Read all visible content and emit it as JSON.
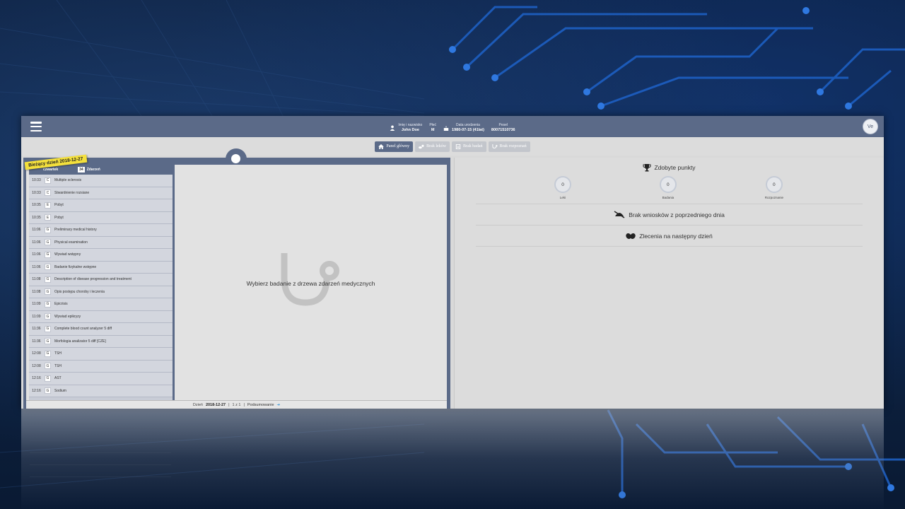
{
  "header": {
    "patient": {
      "name_label": "Imię i nazwisko",
      "name_value": "John Doe",
      "sex_label": "Płeć",
      "sex_value": "M",
      "dob_label": "Data urodzenia",
      "dob_value": "1980-07-15 (41lat)",
      "pesel_label": "Pesel",
      "pesel_value": "80071510736"
    },
    "avatar_initials": "Ve"
  },
  "nav": {
    "items": [
      {
        "label": "Panel główny",
        "icon": "home-icon",
        "active": true
      },
      {
        "label": "Brak leków",
        "icon": "pills-icon",
        "active": false
      },
      {
        "label": "Brak badań",
        "icon": "clipboard-icon",
        "active": false
      },
      {
        "label": "Brak rozpoznań",
        "icon": "stethoscope-icon",
        "active": false
      }
    ]
  },
  "events_panel": {
    "current_day_badge": "Bieżący dzień 2018-12-27",
    "day_name": "czwartek",
    "events_count": "34",
    "events_label": "Zdarzeń",
    "rows": [
      {
        "time": "10:33",
        "kind": "C",
        "title": "Multiple sclerosis"
      },
      {
        "time": "10:33",
        "kind": "C",
        "title": "Stwardnienie rozsiane"
      },
      {
        "time": "10:35",
        "kind": "E",
        "title": "Pobyt"
      },
      {
        "time": "10:35",
        "kind": "E",
        "title": "Pobyt"
      },
      {
        "time": "11:06",
        "kind": "G",
        "title": "Preliminary medical history"
      },
      {
        "time": "11:06",
        "kind": "G",
        "title": "Physical examination"
      },
      {
        "time": "11:06",
        "kind": "G",
        "title": "Wywiad wstępny"
      },
      {
        "time": "11:06",
        "kind": "G",
        "title": "Badanie fizykalne wstępne"
      },
      {
        "time": "11:08",
        "kind": "G",
        "title": "Description of disease progression and treatment"
      },
      {
        "time": "11:08",
        "kind": "G",
        "title": "Opis postępu choroby i leczenia"
      },
      {
        "time": "11:09",
        "kind": "G",
        "title": "Epicrisis"
      },
      {
        "time": "11:09",
        "kind": "G",
        "title": "Wywiad epikryzy"
      },
      {
        "time": "11:36",
        "kind": "G",
        "title": "Complete blood count analyzer 5 diff"
      },
      {
        "time": "11:36",
        "kind": "G",
        "title": "Morfologia analizator 5 diff [CZE]"
      },
      {
        "time": "12:08",
        "kind": "G",
        "title": "TSH"
      },
      {
        "time": "12:08",
        "kind": "G",
        "title": "TSH"
      },
      {
        "time": "12:16",
        "kind": "G",
        "title": "AST"
      },
      {
        "time": "12:16",
        "kind": "G",
        "title": "Sodium"
      }
    ]
  },
  "main": {
    "placeholder": "Wybierz badanie z drzewa zdarzeń medycznych"
  },
  "footer": {
    "day_label": "Dzień",
    "day_value": "2018-12-27",
    "sep1": "|",
    "page": "1 z 1",
    "sep2": "|",
    "summary_link": "Podsumowanie",
    "arrow": "➔"
  },
  "right": {
    "points_title": "Zdobyte punkty",
    "points": [
      {
        "value": "0",
        "label": "Leki"
      },
      {
        "value": "0",
        "label": "Badania"
      },
      {
        "value": "0",
        "label": "Rozpoznanie"
      }
    ],
    "no_requests": "Brak wniosków z poprzedniego dnia",
    "orders_next_day": "Zlecenia na następny dzień"
  },
  "colors": {
    "header_bg": "#5b6a88",
    "badge_yellow": "#f4e03c",
    "link_arrow": "#2a8fd6"
  }
}
